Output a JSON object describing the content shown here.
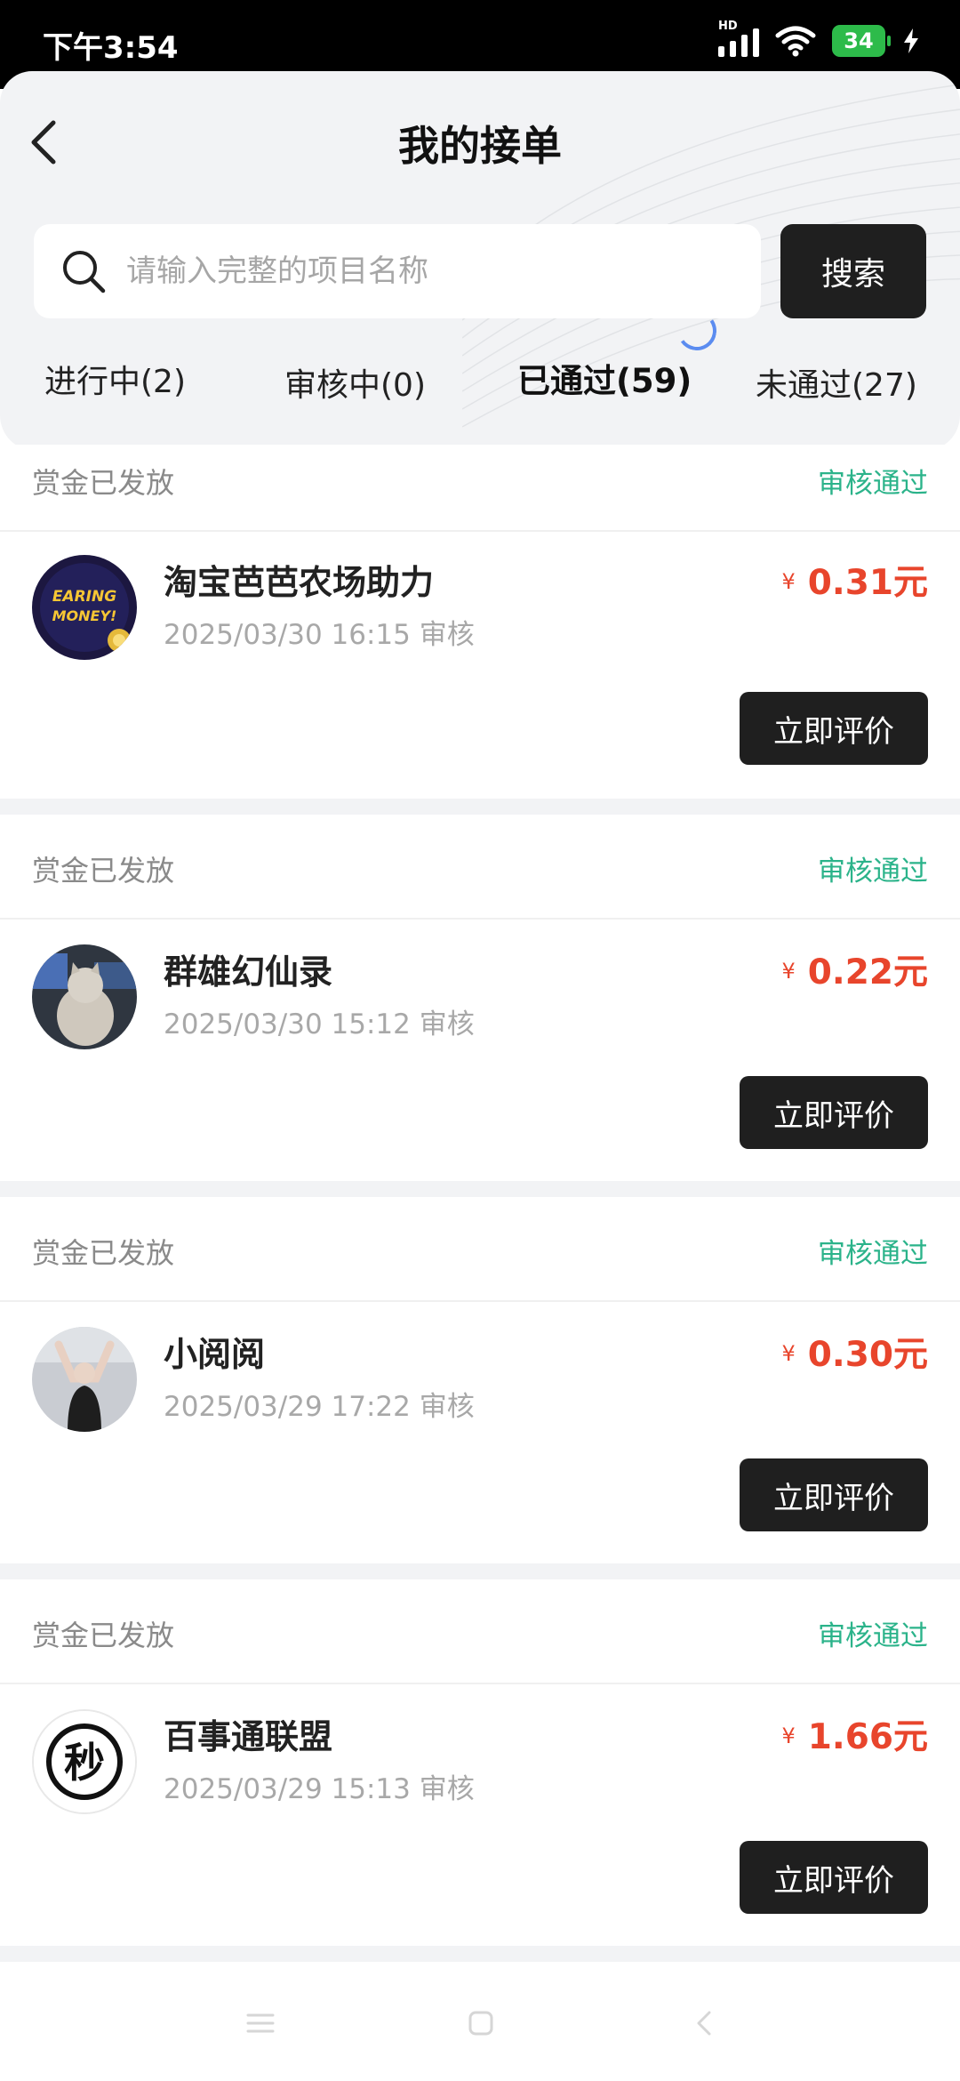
{
  "status_bar": {
    "time": "下午3:54",
    "network_label": "HD",
    "battery": "34"
  },
  "header": {
    "title": "我的接单",
    "search": {
      "placeholder": "请输入完整的项目名称",
      "value": "",
      "button_label": "搜索"
    },
    "tabs": [
      {
        "label": "进行中(2)",
        "active": false
      },
      {
        "label": "审核中(0)",
        "active": false
      },
      {
        "label": "已通过(59)",
        "active": true
      },
      {
        "label": "未通过(27)",
        "active": false
      }
    ]
  },
  "orders": [
    {
      "bounty_status": "赏金已发放",
      "review_status": "审核通过",
      "name": "淘宝芭芭农场助力",
      "review_time": "2025/03/30 16:15 审核",
      "currency": "¥",
      "amount": "0.31元",
      "action_label": "立即评价",
      "avatar_icon": "earning-money-logo",
      "avatar_text": "EARING MONEY!"
    },
    {
      "bounty_status": "赏金已发放",
      "review_status": "审核通过",
      "name": "群雄幻仙录",
      "review_time": "2025/03/30 15:12 审核",
      "currency": "¥",
      "amount": "0.22元",
      "action_label": "立即评价",
      "avatar_icon": "cat-photo"
    },
    {
      "bounty_status": "赏金已发放",
      "review_status": "审核通过",
      "name": "小阅阅",
      "review_time": "2025/03/29 17:22 审核",
      "currency": "¥",
      "amount": "0.30元",
      "action_label": "立即评价",
      "avatar_icon": "person-photo"
    },
    {
      "bounty_status": "赏金已发放",
      "review_status": "审核通过",
      "name": "百事通联盟",
      "review_time": "2025/03/29 15:13 审核",
      "currency": "¥",
      "amount": "1.66元",
      "action_label": "立即评价",
      "avatar_icon": "miao-seal-logo",
      "avatar_text": "秒"
    }
  ],
  "colors": {
    "accent_green": "#2bb38a",
    "price_red": "#e8452c",
    "button_dark": "#1f1f1f"
  }
}
